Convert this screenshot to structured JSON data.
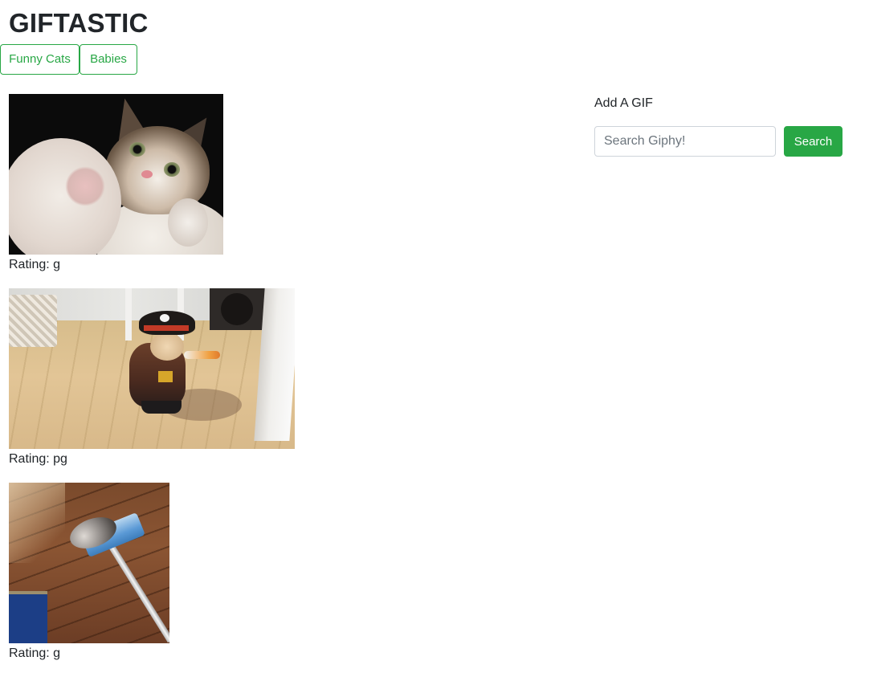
{
  "header": {
    "title": "GIFTASTIC"
  },
  "topics": [
    {
      "label": "Funny Cats"
    },
    {
      "label": "Babies"
    }
  ],
  "gifs": [
    {
      "description": "Kitten swatting at camera",
      "rating_text": "Rating: g"
    },
    {
      "description": "Cat in pirate costume walking",
      "rating_text": "Rating: pg"
    },
    {
      "description": "Kitten riding on a mop",
      "rating_text": "Rating: g"
    }
  ],
  "add_gif": {
    "label": "Add A GIF",
    "placeholder": "Search Giphy!",
    "value": "",
    "button_label": "Search"
  },
  "colors": {
    "accent": "#28a745",
    "text": "#212529",
    "input_border": "#ced4da"
  }
}
